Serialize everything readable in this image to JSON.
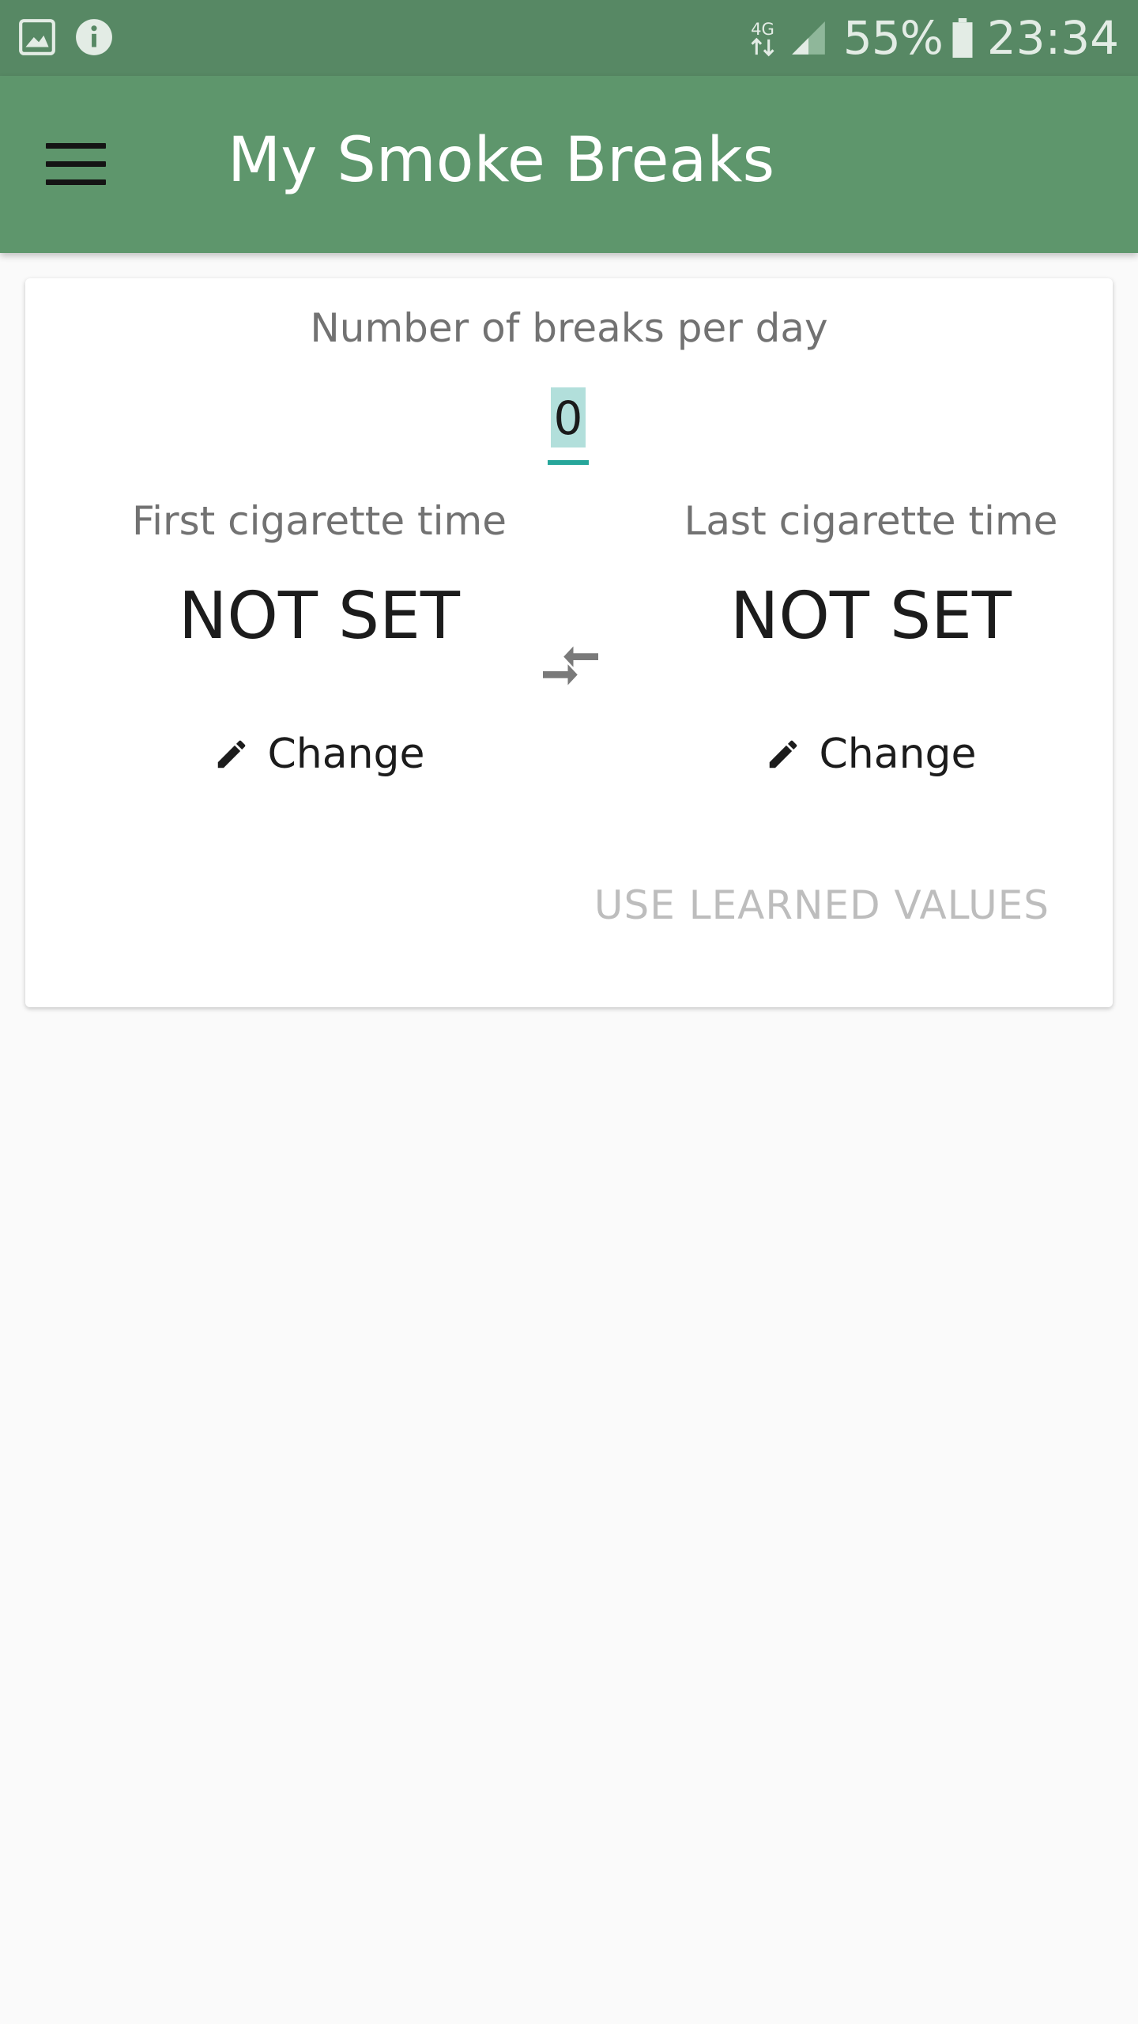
{
  "status_bar": {
    "network": "4G",
    "battery_percent": "55%",
    "time": "23:34",
    "icons": [
      "image-icon",
      "info-icon",
      "network-4g-icon",
      "signal-icon",
      "battery-icon"
    ]
  },
  "app_bar": {
    "title": "My Smoke Breaks",
    "menu_icon": "menu-icon",
    "color": "#5e966c"
  },
  "card": {
    "breaks_heading": "Number of breaks per day",
    "breaks_value": "0",
    "first": {
      "label": "First cigarette time",
      "value": "NOT SET",
      "change_label": "Change"
    },
    "last": {
      "label": "Last cigarette time",
      "value": "NOT SET",
      "change_label": "Change"
    },
    "swap_icon": "compare-arrows-icon",
    "use_learned_label": "USE LEARNED VALUES"
  },
  "colors": {
    "status_bar": "#578864",
    "accent": "#26a69a",
    "selection": "#b2dfdb",
    "disabled_text": "#bdbdbd"
  }
}
